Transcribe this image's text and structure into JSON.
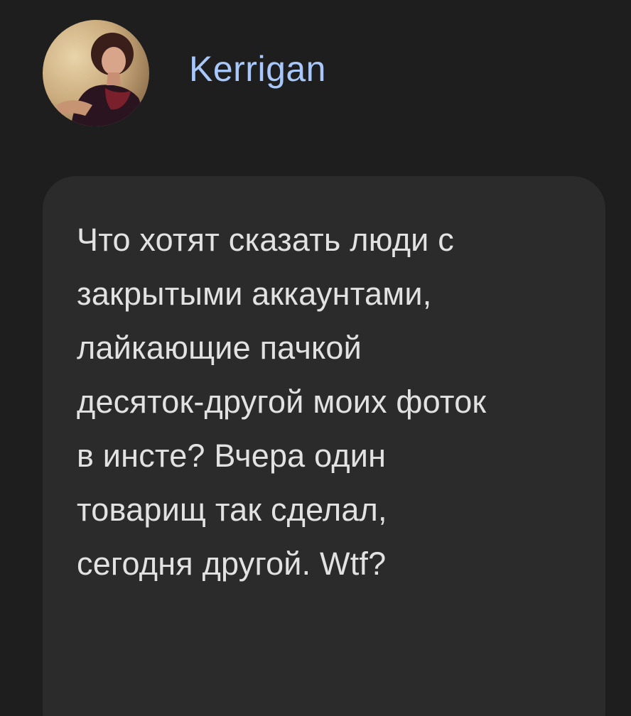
{
  "post": {
    "author": {
      "name": "Kerrigan",
      "avatar_icon": "user-photo-avatar"
    },
    "message": "Что хотят сказать люди с\nзакрытыми аккаунтами,\nлайкающие пачкой\nдесяток-другой моих фоток\nв инсте? Вчера один\nтоварищ так сделал,\nсегодня другой. Wtf?"
  },
  "colors": {
    "background": "#1e1e1e",
    "bubble": "#2b2b2b",
    "username": "#a8c7fa",
    "text": "#e2e2e2"
  }
}
